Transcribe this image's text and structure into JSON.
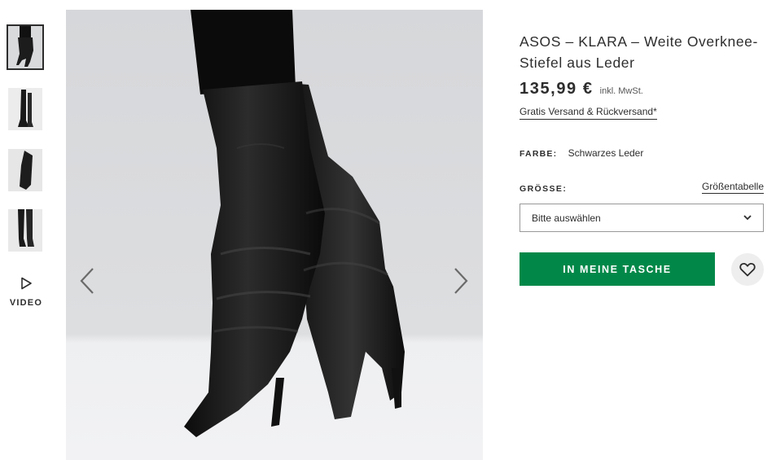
{
  "gallery": {
    "thumbnails": [
      {
        "label": "boots-worn-front",
        "selected": true
      },
      {
        "label": "boots-side-view",
        "selected": false
      },
      {
        "label": "boot-toe-closeup",
        "selected": false
      },
      {
        "label": "boots-worn-back",
        "selected": false
      }
    ],
    "video_label": "VIDEO",
    "prev_icon": "chevron-left-icon",
    "next_icon": "chevron-right-icon",
    "image_bg": "#d9dadc"
  },
  "product": {
    "title": "ASOS – KLARA – Weite Overknee-Stiefel aus Leder",
    "price": "135,99 €",
    "vat_note": "inkl. MwSt.",
    "shipping_link": "Gratis Versand & Rückversand*",
    "color_label": "FARBE:",
    "color_value": "Schwarzes Leder",
    "size_label": "GRÖSSE:",
    "size_guide_link": "Größentabelle",
    "size_placeholder": "Bitte auswählen",
    "add_to_bag": "IN MEINE TASCHE",
    "wishlist_icon": "heart-icon"
  },
  "colors": {
    "accent_green": "#018849",
    "text": "#2d2d2d"
  }
}
